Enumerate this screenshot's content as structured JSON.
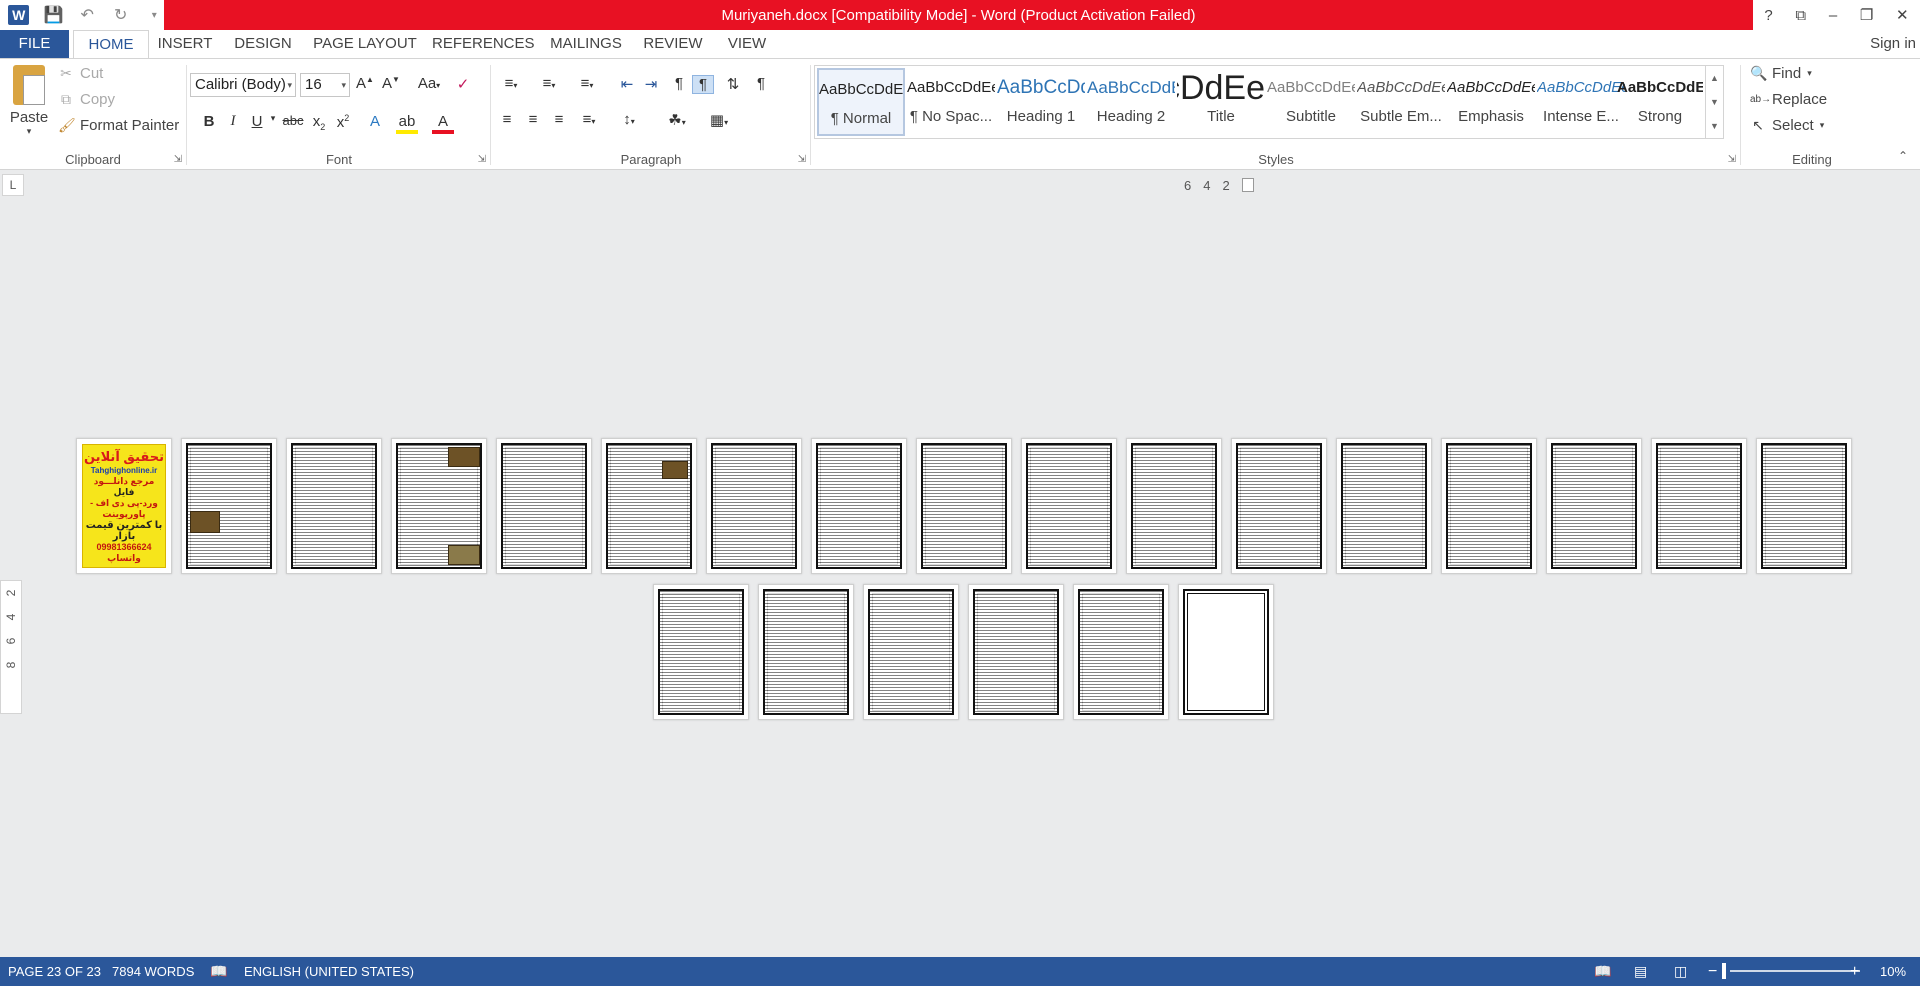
{
  "titlebar": {
    "title": "Muriyaneh.docx [Compatibility Mode] -  Word (Product Activation Failed)",
    "window_controls": [
      "?",
      "⧉",
      "–",
      "❐",
      "✕"
    ]
  },
  "tabs": {
    "file": "FILE",
    "items": [
      "HOME",
      "INSERT",
      "DESIGN",
      "PAGE LAYOUT",
      "REFERENCES",
      "MAILINGS",
      "REVIEW",
      "VIEW"
    ],
    "active": "HOME",
    "signin": "Sign in"
  },
  "clipboard": {
    "paste": "Paste",
    "cut": "Cut",
    "copy": "Copy",
    "format_painter": "Format Painter",
    "label": "Clipboard"
  },
  "font": {
    "name": "Calibri (Body)",
    "size": "16",
    "label": "Font"
  },
  "paragraph": {
    "label": "Paragraph"
  },
  "styles": {
    "label": "Styles",
    "items": [
      {
        "preview": "AaBbCcDdEe",
        "name": "¶ Normal"
      },
      {
        "preview": "AaBbCcDdEe",
        "name": "¶ No Spac..."
      },
      {
        "preview": "AaBbCcDdEe",
        "name": "Heading 1"
      },
      {
        "preview": "AaBbCcDdEe",
        "name": "Heading 2"
      },
      {
        "preview": "AaBbCcDdEe",
        "name": "Title"
      },
      {
        "preview": "AaBbCcDdEe",
        "name": "Subtitle"
      },
      {
        "preview": "AaBbCcDdEe",
        "name": "Subtle Em..."
      },
      {
        "preview": "AaBbCcDdEe",
        "name": "Emphasis"
      },
      {
        "preview": "AaBbCcDdEe",
        "name": "Intense E..."
      },
      {
        "preview": "AaBbCcDdEe",
        "name": "Strong"
      }
    ]
  },
  "editing": {
    "find": "Find",
    "replace": "Replace",
    "select": "Select",
    "label": "Editing"
  },
  "rulers": {
    "corner": "L",
    "h_numbers": [
      "6",
      "4",
      "2"
    ],
    "v_numbers": [
      "2",
      "4",
      "6",
      "8"
    ]
  },
  "cover_page": {
    "line1": "تحقیق آنلاین",
    "line2": "Tahghighonline.ir",
    "line3": "مرجع دانلـــود",
    "line4": "فایل",
    "line5": "ورد-پی دی اف - پاورپوینت",
    "line6": "با کمترین قیمت بازار",
    "line7": "09981366624 واتساپ"
  },
  "status": {
    "page": "PAGE 23 OF 23",
    "words": "7894 WORDS",
    "language": "ENGLISH (UNITED STATES)",
    "zoom": "10%"
  }
}
